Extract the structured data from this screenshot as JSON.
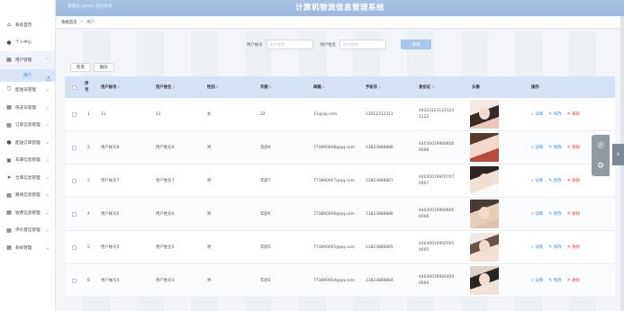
{
  "header": {
    "user_text": "管理员 admin  退出登录",
    "title": "计算机物流信息管理系统"
  },
  "sidebar": {
    "items": [
      {
        "label": "系统首页",
        "icon": "home-icon"
      },
      {
        "label": "个人中心",
        "icon": "user-icon"
      },
      {
        "label": "用户管理",
        "icon": "grid-icon"
      },
      {
        "label": "配送员管理",
        "icon": "shield-icon"
      },
      {
        "label": "快递员管理",
        "icon": "grid-icon"
      },
      {
        "label": "订单信息管理",
        "icon": "grid-icon"
      },
      {
        "label": "配送订单管理",
        "icon": "user-icon"
      },
      {
        "label": "车辆信息管理",
        "icon": "truck-icon"
      },
      {
        "label": "仓库信息管理",
        "icon": "send-icon"
      },
      {
        "label": "路线信息管理",
        "icon": "grid-icon"
      },
      {
        "label": "收费信息管理",
        "icon": "grid-icon"
      },
      {
        "label": "评价意见管理",
        "icon": "grid-icon"
      },
      {
        "label": "系统管理",
        "icon": "grid-icon"
      }
    ],
    "submenu_label": "用户"
  },
  "breadcrumb": {
    "home": "系统首页",
    "sep": "»",
    "current": "用户"
  },
  "search": {
    "account_label": "用户帐号",
    "account_placeholder": "用户帐号",
    "name_label": "用户姓名",
    "name_placeholder": "用户姓名",
    "button": "查询"
  },
  "toolbar": {
    "add": "新增",
    "delete": "删除"
  },
  "table": {
    "headers": [
      "序号",
      "用户帐号",
      "用户姓名",
      "性别",
      "年龄",
      "邮箱",
      "手机号",
      "身份证",
      "头像",
      "操作"
    ],
    "rows": [
      {
        "idx": "1",
        "account": "11",
        "name": "11",
        "gender": "女",
        "age": "22",
        "email": "11@qq.com",
        "phone": "13012312311",
        "idcard": "441231231231231223"
      },
      {
        "idx": "2",
        "account": "用户帐号8",
        "name": "用户姓名8",
        "gender": "男",
        "age": "年龄8",
        "email": "773890008@qq.com",
        "phone": "13823888888",
        "idcard": "440300199808080008"
      },
      {
        "idx": "3",
        "account": "用户帐号7",
        "name": "用户姓名7",
        "gender": "男",
        "age": "年龄7",
        "email": "773890007@qq.com",
        "phone": "13823888887",
        "idcard": "440300199707070007"
      },
      {
        "idx": "4",
        "account": "用户帐号6",
        "name": "用户姓名6",
        "gender": "男",
        "age": "年龄6",
        "email": "773890006@qq.com",
        "phone": "13823888886",
        "idcard": "440300199606060006"
      },
      {
        "idx": "5",
        "account": "用户帐号5",
        "name": "用户姓名5",
        "gender": "男",
        "age": "年龄5",
        "email": "773890005@qq.com",
        "phone": "13823888885",
        "idcard": "440300199505050005"
      },
      {
        "idx": "6",
        "account": "用户帐号4",
        "name": "用户姓名4",
        "gender": "男",
        "age": "年龄4",
        "email": "773890004@qq.com",
        "phone": "13823888884",
        "idcard": "440300199404040004"
      }
    ],
    "actions": {
      "detail": "详情",
      "edit": "修改",
      "delete": "删除"
    }
  },
  "colors": {
    "header": "#9cb8df",
    "accent": "#3c8de6",
    "danger": "#e04a3f",
    "table_head": "#d3e2f4"
  }
}
